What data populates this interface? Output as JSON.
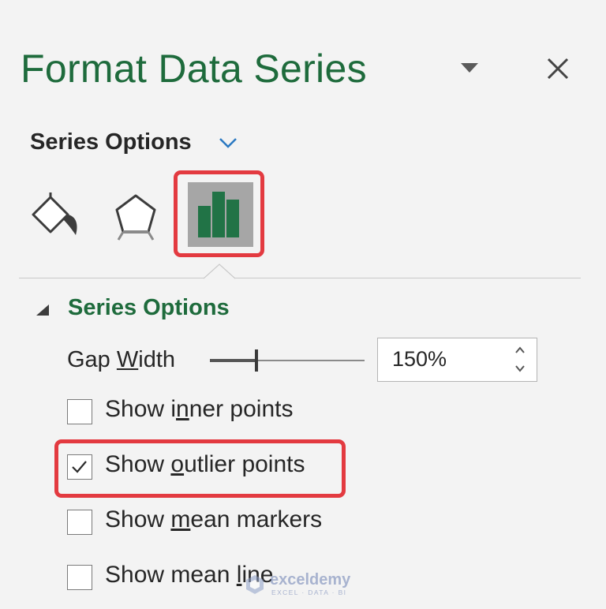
{
  "pane": {
    "title": "Format Data Series",
    "dropdown_icon": "triangle-down-icon",
    "close_icon": "close-icon"
  },
  "series_options_menu": {
    "label": "Series Options",
    "chevron_icon": "chevron-down-icon"
  },
  "tabs": [
    {
      "name": "fill-and-line",
      "icon": "paint-bucket-icon",
      "selected": false
    },
    {
      "name": "effects",
      "icon": "pentagon-icon",
      "selected": false
    },
    {
      "name": "series-options",
      "icon": "bar-chart-icon",
      "selected": true,
      "highlight_color": "#e33a40"
    }
  ],
  "section": {
    "title": "Series Options",
    "expanded": true,
    "gap_width": {
      "label_prefix": "Gap ",
      "label_underlined": "W",
      "label_suffix": "idth",
      "value": "150%",
      "slider_fraction": 0.3
    },
    "checkboxes": [
      {
        "pre": "Show i",
        "ul": "n",
        "post": "ner points",
        "checked": false
      },
      {
        "pre": "Show ",
        "ul": "o",
        "post": "utlier points",
        "checked": true,
        "highlighted": true
      },
      {
        "pre": "Show ",
        "ul": "m",
        "post": "ean markers",
        "checked": false
      },
      {
        "pre": "Show mean ",
        "ul": "l",
        "post": "ine",
        "checked": false
      }
    ]
  },
  "watermark": {
    "name": "exceldemy",
    "tagline": "EXCEL · DATA · BI"
  },
  "colors": {
    "accent_green": "#1e6b3c",
    "chart_green": "#217346",
    "highlight_red": "#e33a40",
    "link_blue": "#2b79c2",
    "panel_bg": "#f3f3f3"
  }
}
